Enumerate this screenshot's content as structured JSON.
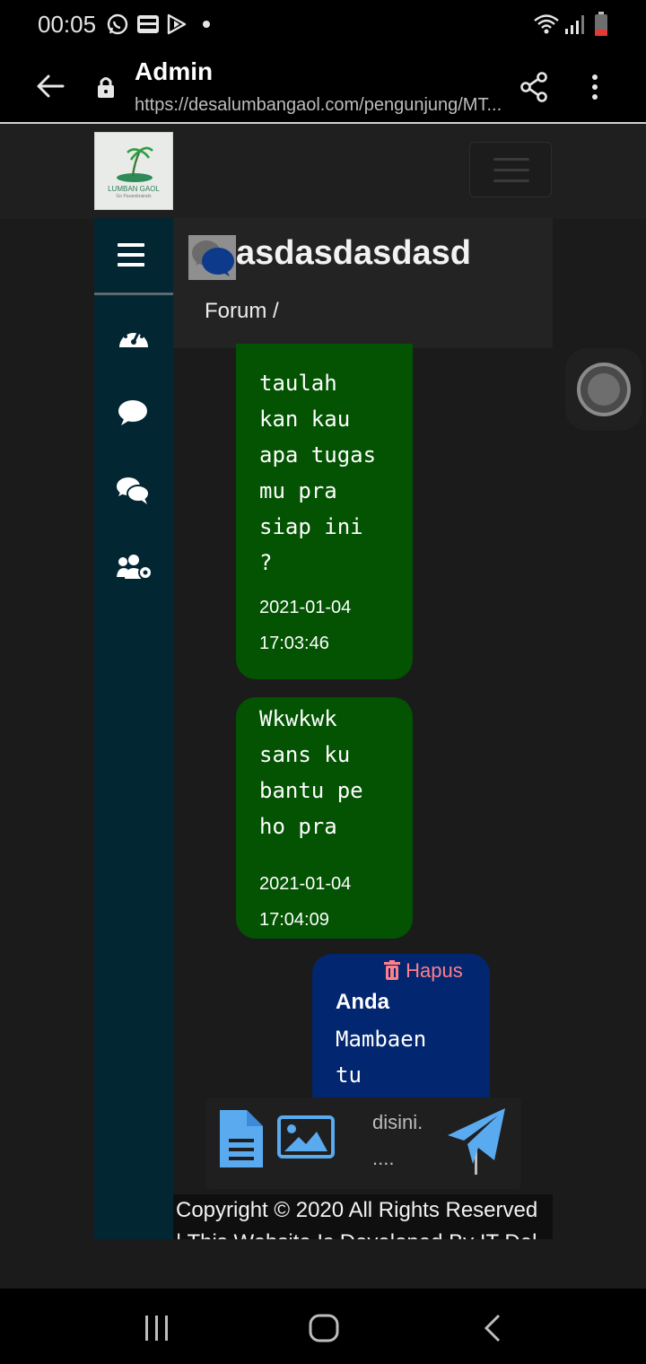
{
  "status_bar": {
    "time": "00:05",
    "app_icons": [
      "whatsapp-icon",
      "webtoon-icon",
      "play-icon",
      "dot-icon"
    ],
    "system_icons": [
      "wifi-icon",
      "signal-icon",
      "battery-low-icon"
    ]
  },
  "browser": {
    "title": "Admin",
    "url": "https://desalumbangaol.com/pengunjung/MT...",
    "icons": [
      "back-arrow-icon",
      "lock-icon",
      "share-icon",
      "more-vert-icon"
    ]
  },
  "site": {
    "logo_text": "LUMBAN GAOL",
    "logo_sub": "Go Paramitraindo"
  },
  "sidebar": {
    "items": [
      {
        "icon": "menu-icon"
      },
      {
        "icon": "dashboard-gauge-icon"
      },
      {
        "icon": "comment-icon"
      },
      {
        "icon": "comments-icon"
      },
      {
        "icon": "users-cog-icon"
      }
    ]
  },
  "chat": {
    "title": "asdasdasdasd",
    "breadcrumb": "Forum /",
    "messages": [
      {
        "text": "taulah\nkan kau\napa tugas\nmu pra\nsiap ini\n?",
        "time": "2021-01-04\n17:03:46"
      },
      {
        "text": "Wkwkwk\nsans ku\nbantu pe\nho pra",
        "time": "2021-01-04\n17:04:09"
      }
    ],
    "mine": {
      "delete_label": "Hapus",
      "sender": "Anda",
      "text": "Mambaen\ntu"
    }
  },
  "composer": {
    "placeholder": "disini.\n....",
    "icons": [
      "file-alt-icon",
      "image-icon",
      "paper-plane-icon"
    ]
  },
  "footer": {
    "copyright": "Copyright © 2020 All Rights Reserved",
    "second_line": "| This Website Is Developed By IT Del"
  },
  "colors": {
    "sidebar_bg": "#032633",
    "bubble_other": "#035303",
    "bubble_mine": "#032670",
    "accent_blue": "#5aaaf0",
    "delete_red": "#ff7f8a"
  }
}
